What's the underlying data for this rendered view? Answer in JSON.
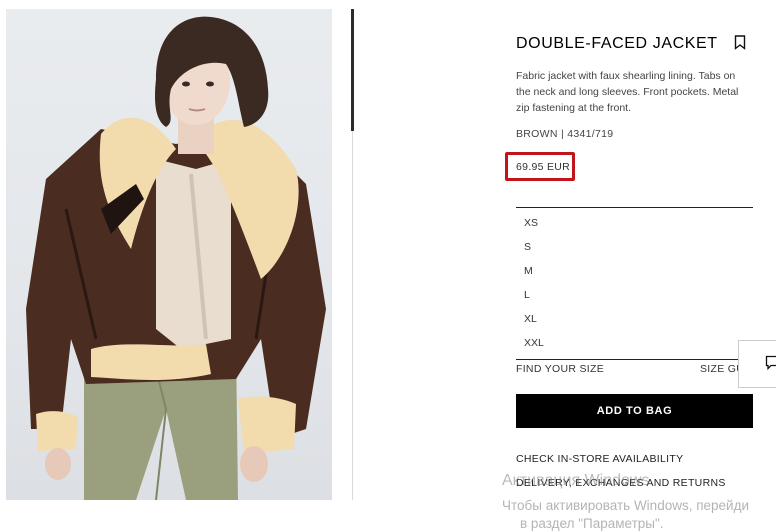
{
  "product": {
    "title": "DOUBLE-FACED JACKET",
    "description": "Fabric jacket with faux shearling lining. Tabs on the neck and long sleeves. Front pockets. Metal zip fastening at the front.",
    "color_ref": "BROWN | 4341/719",
    "price": "69.95 EUR",
    "sizes": [
      "XS",
      "S",
      "M",
      "L",
      "XL",
      "XXL"
    ],
    "find_your_size": "FIND YOUR SIZE",
    "size_guide": "SIZE GU",
    "add_to_bag": "ADD TO BAG",
    "check_store": "CHECK IN-STORE AVAILABILITY",
    "delivery": "DELIVERY, EXCHANGES AND RETURNS"
  },
  "icons": {
    "bookmark": "bookmark-icon",
    "chat": "chat-icon"
  },
  "colors": {
    "highlight_border": "#c3141b",
    "button_bg": "#000000",
    "jacket": "#4a2c20",
    "shearling": "#f2dcae",
    "trousers": "#9aa07e"
  },
  "watermark": {
    "line1": "Активация Windows",
    "line2": "Чтобы активировать Windows, перейди",
    "line3": "в раздел \"Параметры\"."
  }
}
